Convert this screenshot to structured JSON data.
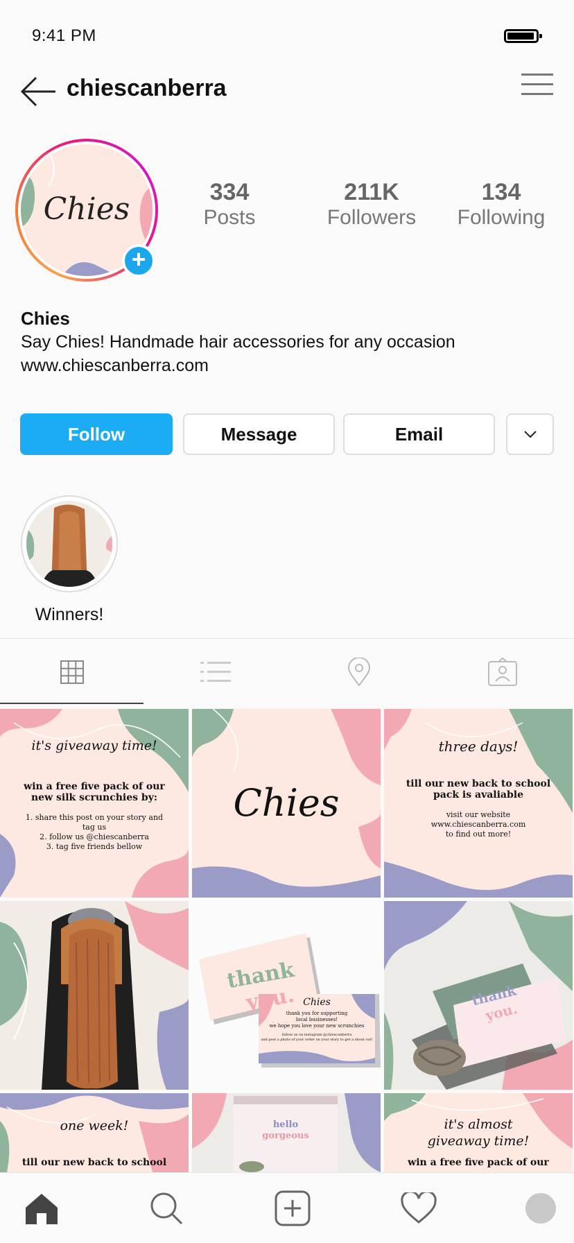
{
  "status_bar": {
    "time": "9:41 PM"
  },
  "header": {
    "username": "chiescanberra"
  },
  "profile": {
    "avatar_text": "Chies",
    "stats": [
      {
        "value": "334",
        "label": "Posts"
      },
      {
        "value": "211K",
        "label": "Followers"
      },
      {
        "value": "134",
        "label": "Following"
      }
    ],
    "name": "Chies",
    "bio": "Say Chies! Handmade hair accessories for any occasion",
    "website": "www.chiescanberra.com"
  },
  "actions": {
    "follow": "Follow",
    "message": "Message",
    "email": "Email"
  },
  "highlights": [
    {
      "label": "Winners!"
    }
  ],
  "posts": {
    "p1": {
      "title": "it's giveaway time!",
      "body1": "win a free five pack of our",
      "body2": "new silk scrunchies by:",
      "l1": "1. share this post on your story and",
      "l2": "tag us",
      "l3": "2. follow us @chiescanberra",
      "l4": "3. tag five friends bellow"
    },
    "p2": {
      "logo": "Chies"
    },
    "p3": {
      "title": "three days!",
      "body1": "till our new back to school",
      "body2": "pack is avaliable",
      "l1": "visit our website",
      "l2": "www.chiescanberra.com",
      "l3": "to find out more!"
    },
    "p5": {
      "thank": "thank",
      "you": "you.",
      "logo": "Chies",
      "m1": "thank you for supporting",
      "m2": "local businesses!",
      "m3": "we hope you love your new scrunchies",
      "m4": "follow us on instagram @chiescanberra",
      "m5": "and post a photo of your order on your story to get a shout out!"
    },
    "p6": {
      "thank": "thank",
      "you": "you."
    },
    "p7": {
      "title": "one week!",
      "body1": "till our new back to school"
    },
    "p8": {
      "hello": "hello",
      "gorgeous": "gorgeous"
    },
    "p9": {
      "title1": "it's almost",
      "title2": "giveaway time!",
      "body1": "win a free five pack of our"
    }
  },
  "colors": {
    "accent": "#1cacf4",
    "pink": "#f3a9b3",
    "green": "#8fb39b",
    "lavender": "#9a9cc7",
    "cream": "#fde9e1"
  }
}
